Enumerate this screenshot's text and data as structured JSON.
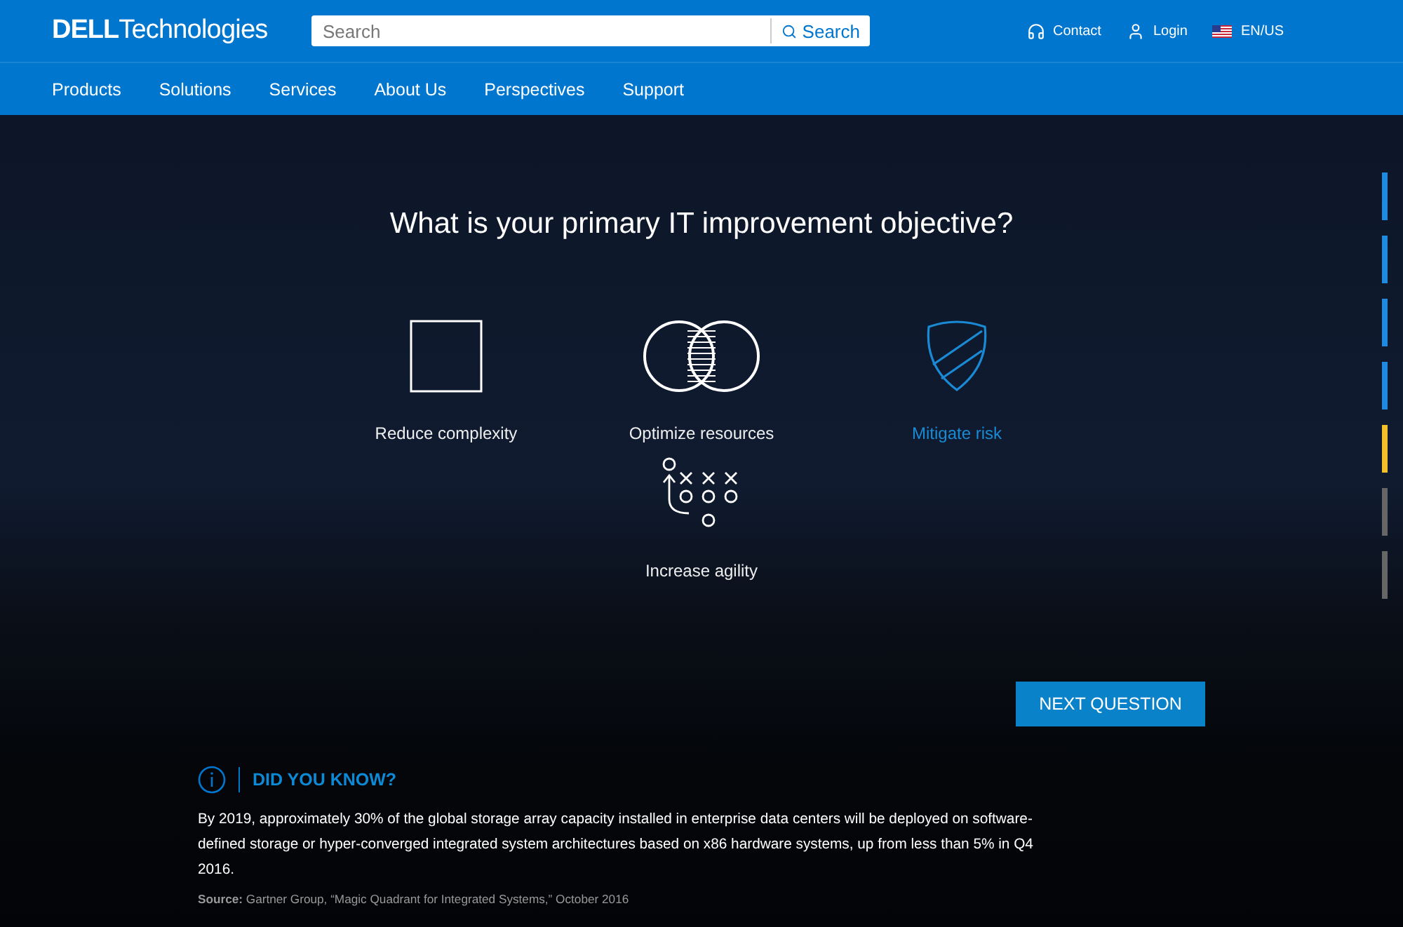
{
  "header": {
    "logo": {
      "brand": "DELL",
      "product": "Technologies"
    },
    "search": {
      "placeholder": "Search",
      "button": "Search"
    },
    "links": [
      {
        "label": "Contact",
        "kind": "contact"
      },
      {
        "label": "Login",
        "kind": "login"
      },
      {
        "label": "EN/US",
        "kind": "locale"
      }
    ]
  },
  "nav": {
    "items": [
      "Products",
      "Solutions",
      "Services",
      "About Us",
      "Perspectives",
      "Support"
    ]
  },
  "quiz": {
    "question": "What is your primary IT improvement objective?",
    "options": [
      {
        "label": "Reduce complexity",
        "kind": "square",
        "selected": false
      },
      {
        "label": "Optimize resources",
        "kind": "venn",
        "selected": false
      },
      {
        "label": "Mitigate risk",
        "kind": "shield",
        "selected": true
      },
      {
        "label": "Increase agility",
        "kind": "playbook",
        "selected": false
      }
    ],
    "next_button": "NEXT QUESTION",
    "progress": [
      {
        "completed": true,
        "current": false
      },
      {
        "completed": true,
        "current": false
      },
      {
        "completed": true,
        "current": false
      },
      {
        "completed": true,
        "current": false
      },
      {
        "completed": false,
        "current": true
      },
      {
        "completed": false,
        "current": false
      },
      {
        "completed": false,
        "current": false
      }
    ]
  },
  "fact": {
    "title": "DID YOU KNOW?",
    "text": "By 2019, approximately 30% of the global storage array capacity installed in enterprise data centers will be deployed on software-defined storage or hyper-converged integrated system architectures based on x86 hardware systems, up from less than 5% in Q4 2016.",
    "source": "**Source:** Gartner Group, “Magic Quadrant for Integrated Systems,” October 2016"
  }
}
